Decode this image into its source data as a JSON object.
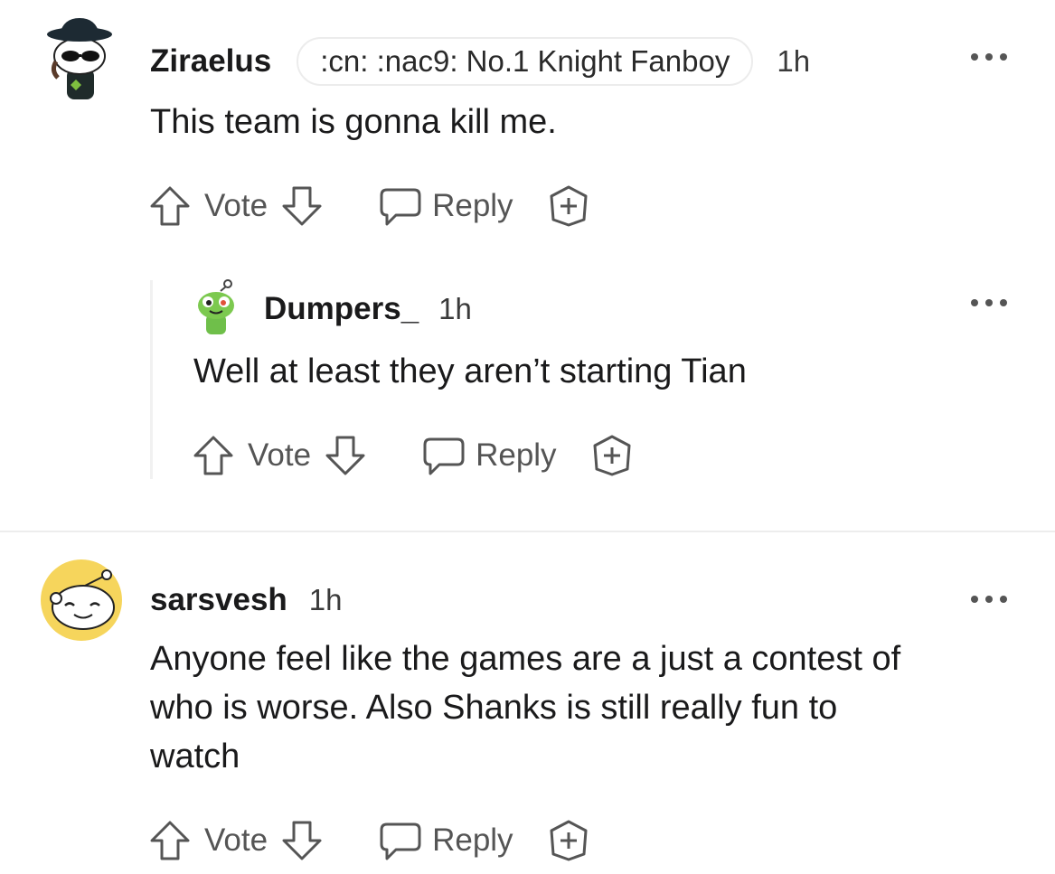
{
  "comments": [
    {
      "username": "Ziraelus",
      "flair": ":cn: :nac9: No.1 Knight Fanboy",
      "time": "1h",
      "body": "This team is gonna kill me.",
      "vote_label": "Vote",
      "reply_label": "Reply"
    },
    {
      "username": "Dumpers_",
      "time": "1h",
      "body": "Well at least they aren’t starting Tian",
      "vote_label": "Vote",
      "reply_label": "Reply"
    },
    {
      "username": "sarsvesh",
      "time": "1h",
      "body_lines": [
        "Anyone feel like the games are a just a contest of",
        "who is worse. Also Shanks is still really fun to",
        "watch"
      ],
      "vote_label": "Vote",
      "reply_label": "Reply"
    }
  ],
  "icons": {
    "upvote": "arrow-up-icon",
    "downvote": "arrow-down-icon",
    "reply": "speech-bubble-icon",
    "award": "plus-badge-icon",
    "more": "more-options-icon"
  }
}
